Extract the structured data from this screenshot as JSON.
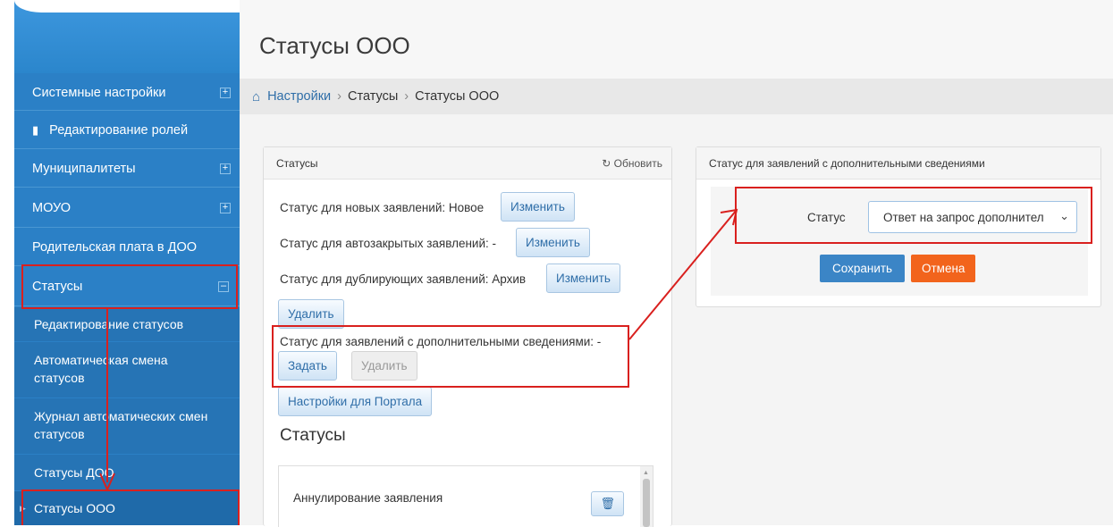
{
  "page": {
    "title": "Статусы ООО"
  },
  "breadcrumbs": {
    "home": "Настройки",
    "sep1": "›",
    "level2": "Статусы",
    "sep2": "›",
    "level3": "Статусы ООО"
  },
  "sidebar": {
    "items": [
      {
        "label": "Системные настройки",
        "toggle": "+"
      },
      {
        "label": "Редактирование ролей"
      },
      {
        "label": "Муниципалитеты",
        "toggle": "+"
      },
      {
        "label": "МОУО",
        "toggle": "+"
      },
      {
        "label": "Родительская плата в ДОО"
      },
      {
        "label": "Статусы",
        "toggle": "–"
      }
    ],
    "subitems": [
      {
        "label": "Редактирование статусов"
      },
      {
        "label": "Автоматическая смена статусов"
      },
      {
        "label": "Журнал автоматических смен статусов"
      },
      {
        "label": "Статусы ДОО"
      },
      {
        "label": "Статусы ООО"
      }
    ]
  },
  "statuses_panel": {
    "title": "Статусы",
    "refresh_label": "Обновить",
    "new_status_text": "Статус для новых заявлений: Новое",
    "auto_closed_text": "Статус для автозакрытых заявлений: -",
    "duplicate_text": "Статус для дублирующих заявлений: Архив",
    "change_label": "Изменить",
    "delete_label": "Удалить",
    "additional_text": "Статус для заявлений с дополнительными сведениями: -",
    "set_label": "Задать",
    "portal_settings_label": "Настройки для Портала",
    "list_heading": "Статусы",
    "list_items": [
      "Аннулирование заявления"
    ]
  },
  "additional_panel": {
    "title": "Статус для заявлений с дополнительными сведениями",
    "status_label": "Статус",
    "status_selected": "Ответ на запрос дополнител",
    "save_label": "Сохранить",
    "cancel_label": "Отмена"
  },
  "colors": {
    "sidebar": "#2b80c6",
    "annotation": "#d9201e",
    "primary": "#3b85c6",
    "danger": "#f2641c"
  }
}
